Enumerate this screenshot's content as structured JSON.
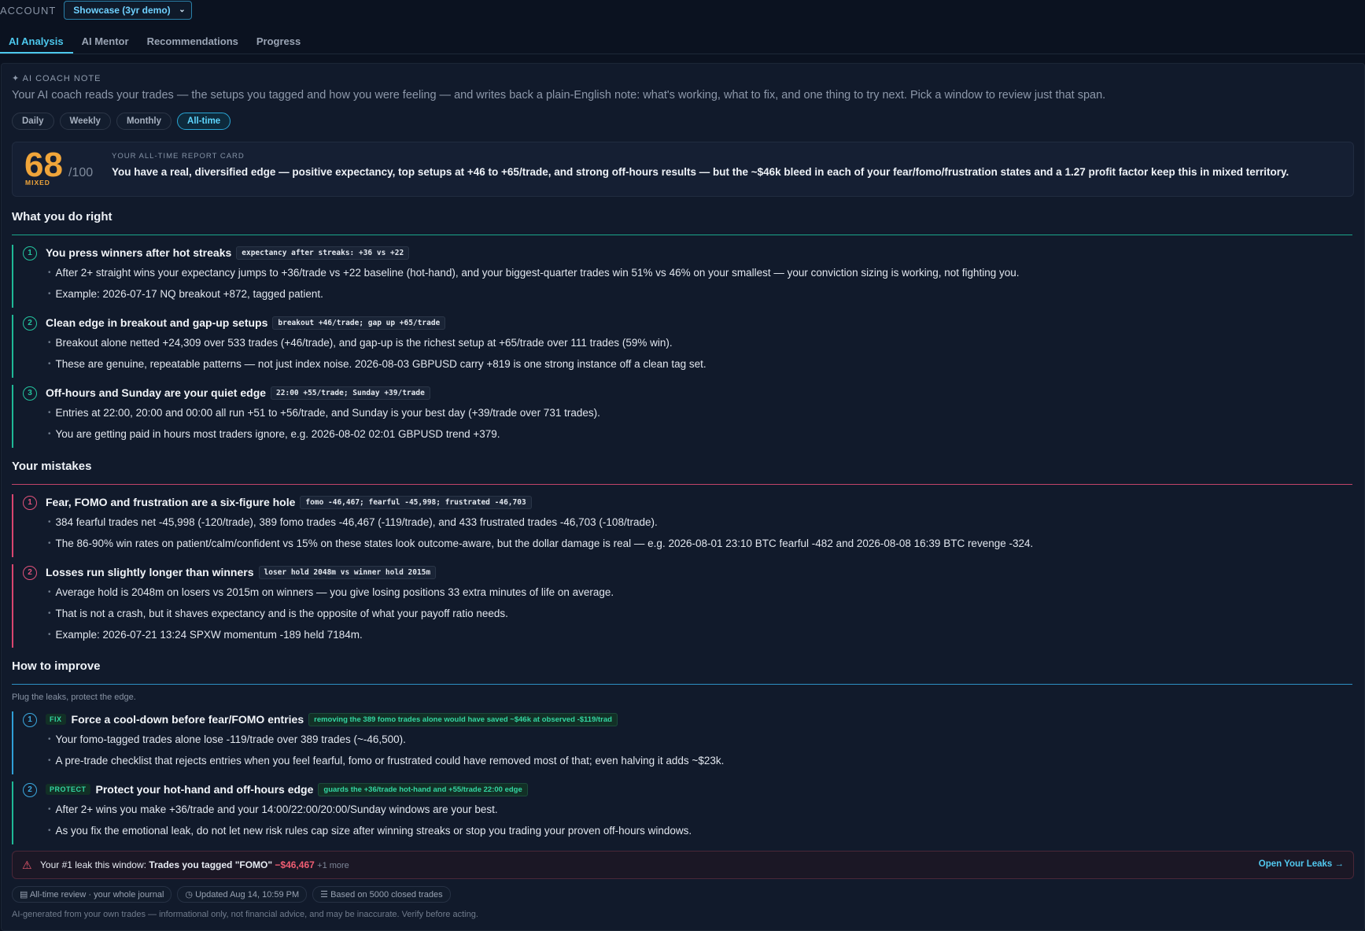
{
  "account": {
    "label": "ACCOUNT",
    "selected": "Showcase (3yr demo)"
  },
  "tabs": [
    "AI Analysis",
    "AI Mentor",
    "Recommendations",
    "Progress"
  ],
  "coach": {
    "label": "✦ AI COACH NOTE",
    "intro": "Your AI coach reads your trades — the setups you tagged and how you were feeling — and writes back a plain-English note: what's working, what to fix, and one thing to try next. Pick a window to review just that span.",
    "windows": [
      "Daily",
      "Weekly",
      "Monthly",
      "All-time"
    ],
    "active_window": "All-time"
  },
  "report": {
    "score": "68",
    "denom": "/100",
    "grade": "MIXED",
    "kicker": "YOUR ALL-TIME REPORT CARD",
    "summary": "You have a real, diversified edge — positive expectancy, top setups at +46 to +65/trade, and strong off-hours results — but the ~$46k bleed in each of your fear/fomo/frustration states and a 1.27 profit factor keep this in mixed territory."
  },
  "right": {
    "heading": "What you do right",
    "items": [
      {
        "n": "1",
        "title": "You press winners after hot streaks",
        "chip": "expectancy after streaks: +36 vs +22",
        "bullets": [
          "After 2+ straight wins your expectancy jumps to +36/trade vs +22 baseline (hot-hand), and your biggest-quarter trades win 51% vs 46% on your smallest — your conviction sizing is working, not fighting you.",
          "Example: 2026-07-17 NQ breakout +872, tagged patient."
        ]
      },
      {
        "n": "2",
        "title": "Clean edge in breakout and gap-up setups",
        "chip": "breakout +46/trade; gap up +65/trade",
        "bullets": [
          "Breakout alone netted +24,309 over 533 trades (+46/trade), and gap-up is the richest setup at +65/trade over 111 trades (59% win).",
          "These are genuine, repeatable patterns — not just index noise. 2026-08-03 GBPUSD carry +819 is one strong instance off a clean tag set."
        ]
      },
      {
        "n": "3",
        "title": "Off-hours and Sunday are your quiet edge",
        "chip": "22:00 +55/trade; Sunday +39/trade",
        "bullets": [
          "Entries at 22:00, 20:00 and 00:00 all run +51 to +56/trade, and Sunday is your best day (+39/trade over 731 trades).",
          "You are getting paid in hours most traders ignore, e.g. 2026-08-02 02:01 GBPUSD trend +379."
        ]
      }
    ]
  },
  "mistakes": {
    "heading": "Your mistakes",
    "items": [
      {
        "n": "1",
        "title": "Fear, FOMO and frustration are a six-figure hole",
        "chip": "fomo -46,467; fearful -45,998; frustrated -46,703",
        "bullets": [
          "384 fearful trades net -45,998 (-120/trade), 389 fomo trades -46,467 (-119/trade), and 433 frustrated trades -46,703 (-108/trade).",
          "The 86-90% win rates on patient/calm/confident vs 15% on these states look outcome-aware, but the dollar damage is real — e.g. 2026-08-01 23:10 BTC fearful -482 and 2026-08-08 16:39 BTC revenge -324."
        ]
      },
      {
        "n": "2",
        "title": "Losses run slightly longer than winners",
        "chip": "loser hold 2048m vs winner hold 2015m",
        "bullets": [
          "Average hold is 2048m on losers vs 2015m on winners — you give losing positions 33 extra minutes of life on average.",
          "That is not a crash, but it shaves expectancy and is the opposite of what your payoff ratio needs.",
          "Example: 2026-07-21 13:24 SPXW momentum -189 held 7184m."
        ]
      }
    ]
  },
  "improve": {
    "heading": "How to improve",
    "subtitle": "Plug the leaks, protect the edge.",
    "items": [
      {
        "n": "1",
        "tag": "FIX",
        "title": "Force a cool-down before fear/FOMO entries",
        "chip": "removing the 389 fomo trades alone would have saved ~$46k at observed -$119/trad",
        "bullets": [
          "Your fomo-tagged trades alone lose -119/trade over 389 trades (~-46,500).",
          "A pre-trade checklist that rejects entries when you feel fearful, fomo or frustrated could have removed most of that; even halving it adds ~$23k."
        ]
      },
      {
        "n": "2",
        "tag": "PROTECT",
        "title": "Protect your hot-hand and off-hours edge",
        "chip": "guards the +36/trade hot-hand and +55/trade 22:00 edge",
        "bullets": [
          "After 2+ wins you make +36/trade and your 14:00/22:00/20:00/Sunday windows are your best.",
          "As you fix the emotional leak, do not let new risk rules cap size after winning streaks or stop you trading your proven off-hours windows."
        ]
      }
    ]
  },
  "leak": {
    "prefix": "Your #1 leak this window:",
    "name": "Trades you tagged \"FOMO\"",
    "amount": "−$46,467",
    "more": "+1 more",
    "cta": "Open Your Leaks →"
  },
  "footer": {
    "chips": [
      "All-time review · your whole journal",
      "Updated Aug 14, 10:59 PM",
      "Based on 5000 closed trades"
    ],
    "disclaimer": "AI-generated from your own trades — informational only, not financial advice, and may be inaccurate. Verify before acting."
  },
  "colors": {
    "accent": "#4cc7ec",
    "positive": "#24c49f",
    "negative": "#e0527a",
    "improve": "#3ba8de",
    "score": "#f0a53a"
  }
}
